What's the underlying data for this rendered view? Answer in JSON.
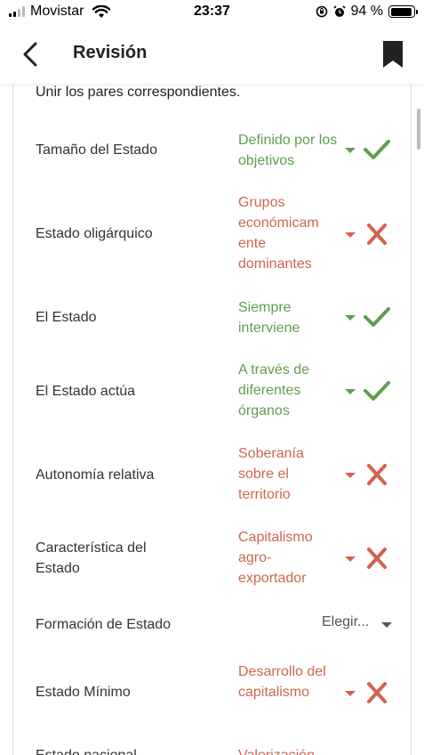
{
  "status_bar": {
    "carrier": "Movistar",
    "time": "23:37",
    "battery": "94 %",
    "battery_level": 0.94,
    "signal_bars": 2
  },
  "header": {
    "title": "Revisión"
  },
  "quiz": {
    "instruction": "Unir los pares correspondientes.",
    "rows": [
      {
        "left": "Tamaño del Estado",
        "answer": "Definido por los objetivos",
        "status": "correct"
      },
      {
        "left": "Estado oligárquico",
        "answer": "Grupos económicam ente dominantes",
        "status": "incorrect"
      },
      {
        "left": "El Estado",
        "answer": "Siempre interviene",
        "status": "correct"
      },
      {
        "left": "El Estado actúa",
        "answer": "A través de diferentes órganos",
        "status": "correct"
      },
      {
        "left": "Autonomía relativa",
        "answer": "Soberanía sobre el territorio",
        "status": "incorrect"
      },
      {
        "left": "Característica del Estado",
        "answer": "Capitalismo agro-exportador",
        "status": "incorrect"
      },
      {
        "left": "Formación de Estado",
        "answer": "Elegir...",
        "status": "unanswered"
      },
      {
        "left": "Estado Mínimo",
        "answer": "Desarrollo del capitalismo",
        "status": "incorrect"
      },
      {
        "left": "Estado nacional",
        "answer": "Valorización",
        "status": "incorrect"
      }
    ]
  },
  "colors": {
    "correct": "#5f9e51",
    "incorrect": "#cf6550",
    "neutral": "#555555"
  },
  "icons": {
    "back": "chevron-left-icon",
    "bookmark": "bookmark-icon",
    "correct": "check-icon",
    "incorrect": "cross-icon"
  }
}
